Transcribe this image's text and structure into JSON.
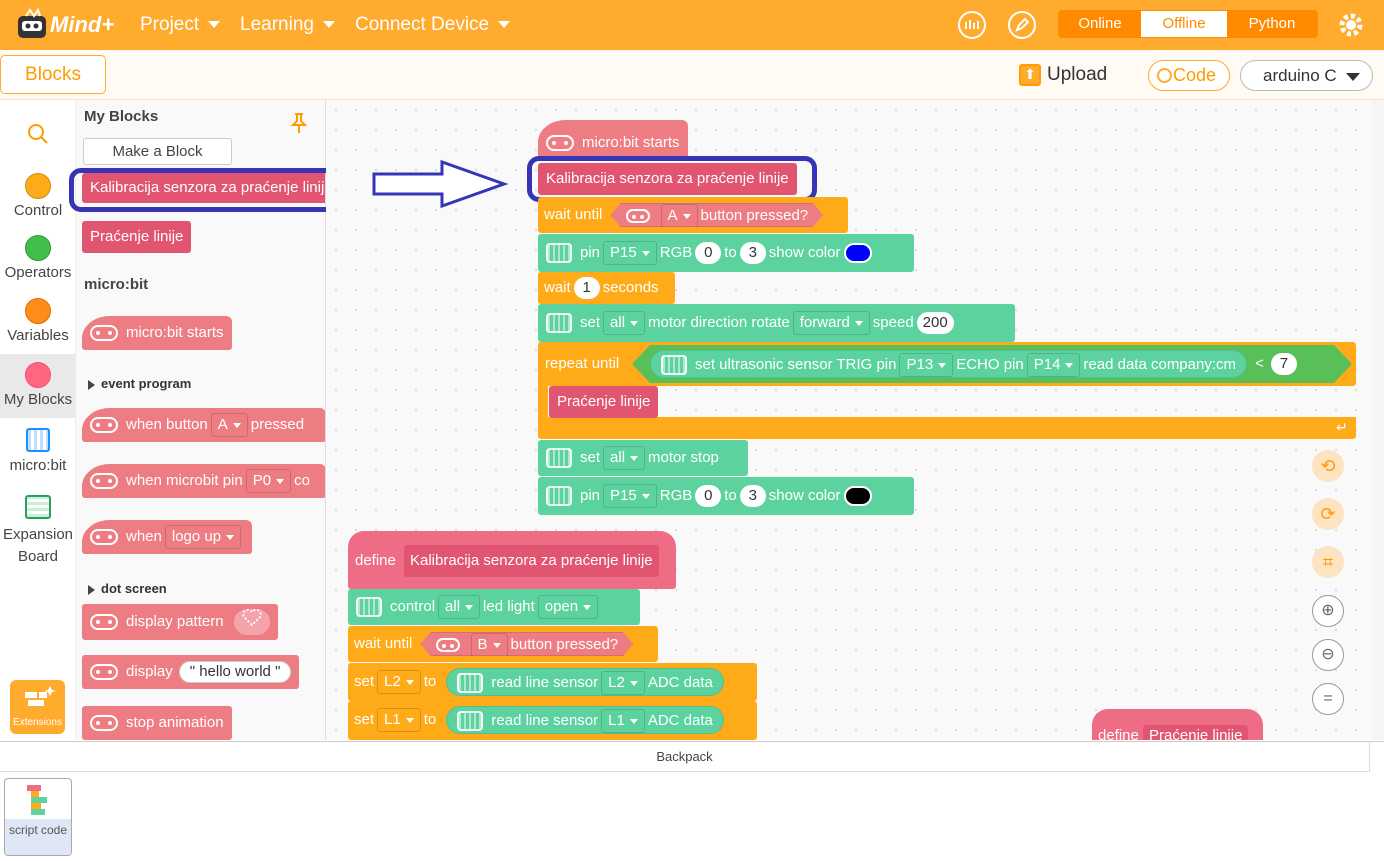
{
  "app": {
    "logo_text": "Mind+"
  },
  "topbar": {
    "menus": [
      {
        "label": "Project"
      },
      {
        "label": "Learning"
      },
      {
        "label": "Connect Device"
      }
    ],
    "icons": [
      "chart-icon",
      "edit-icon",
      "gear-icon"
    ],
    "modes": [
      "Online",
      "Offline",
      "Python"
    ],
    "selected_mode": "Offline",
    "accent": "#ffab2e"
  },
  "subbar": {
    "blocks_tab": "Blocks",
    "upload": "Upload",
    "code": "Code",
    "board": "arduino C"
  },
  "categories": [
    {
      "label": "Control",
      "color": "#ffab19"
    },
    {
      "label": "Operators",
      "color": "#40bf4a"
    },
    {
      "label": "Variables",
      "color": "#ff8c1a"
    },
    {
      "label": "My Blocks",
      "color": "#ff6680"
    },
    {
      "label": "micro:bit"
    },
    {
      "label": "Expansion Board"
    }
  ],
  "extensions": "Extensions",
  "flyout": {
    "my_blocks_title": "My Blocks",
    "make_block": "Make a Block",
    "custom_1": "Kalibracija senzora za praćenje linije",
    "custom_2": "Praćenje linije",
    "microbit_title": "micro:bit",
    "microbit_starts": "micro:bit starts",
    "event_program": "event program",
    "when_button": "when button",
    "btn_a": "A",
    "pressed": "pressed",
    "when_pin": "when microbit pin",
    "pin_p0": "P0",
    "pin_tail": "co",
    "when": "when",
    "logo_up": "logo up",
    "dot_screen": "dot screen",
    "display_pattern": "display pattern",
    "display": "display",
    "hello": "\" hello world \"",
    "stop_animation": "stop animation"
  },
  "script1": {
    "hat": "micro:bit starts",
    "call": "Kalibracija senzora za praćenje linije",
    "wait_until": "wait until",
    "btn": "A",
    "button_pressed": "button pressed?",
    "pin": "pin",
    "p15": "P15",
    "rgb": "RGB",
    "n0": "0",
    "to": "to",
    "n3": "3",
    "show_color": "show color",
    "color_blue": "#0000ff",
    "wait": "wait",
    "n1": "1",
    "seconds": "seconds",
    "set": "set",
    "all": "all",
    "motor_direction": "motor direction rotate",
    "forward": "forward",
    "speed": "speed",
    "n200": "200",
    "repeat_until": "repeat until",
    "us_sensor": "set ultrasonic sensor TRIG pin",
    "p13": "P13",
    "echo": "ECHO pin",
    "p14": "P14",
    "read_cm": "read data company:cm",
    "lt": "<",
    "n7": "7",
    "inner_call": "Praćenje linije",
    "motor_stop": "motor stop",
    "color_black": "#000000"
  },
  "script2": {
    "define": "define",
    "def_name": "Kalibracija senzora za praćenje linije",
    "control": "control",
    "all": "all",
    "led_light": "led light",
    "open": "open",
    "wait_until": "wait until",
    "btn_b": "B",
    "button_pressed": "button pressed?",
    "set": "set",
    "l2": "L2",
    "to": "to",
    "read_line": "read line sensor",
    "adc": "ADC data",
    "l1": "L1"
  },
  "script3": {
    "define": "define",
    "name": "Praćenje linije"
  },
  "backpack": {
    "title": "Backpack",
    "item_label": "script code"
  }
}
